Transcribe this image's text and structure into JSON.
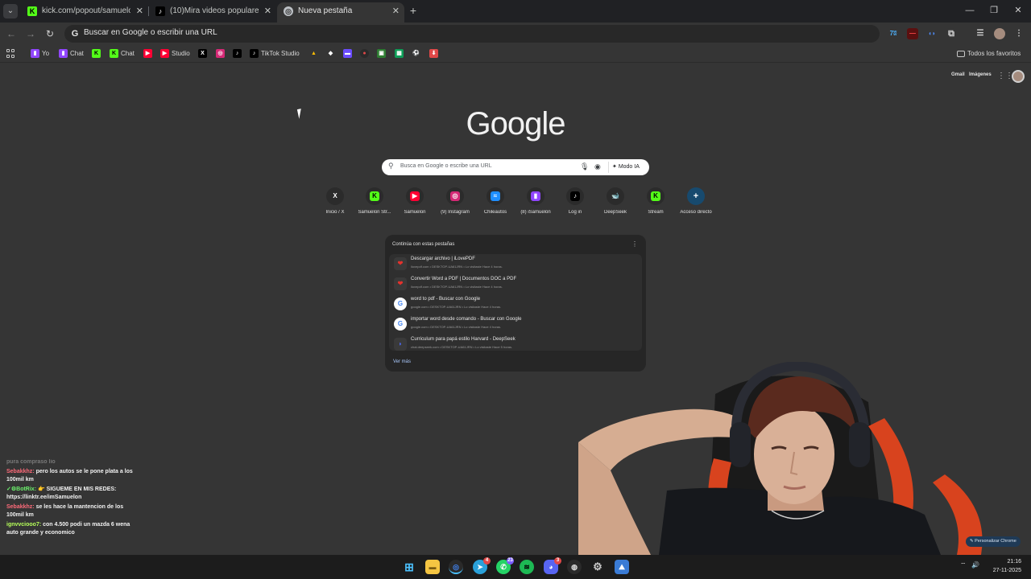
{
  "colors": {
    "accent": "#a8c7fa",
    "kick": "#53fc18",
    "twitch": "#9146ff",
    "youtube": "#ff0033"
  },
  "tabs": [
    {
      "title": "kick.com/popout/samuelon/chat",
      "icon": "kick-icon"
    },
    {
      "title": "(10)Mira videos populares seleccionados",
      "icon": "tiktok-icon"
    },
    {
      "title": "Nueva pestaña",
      "icon": "chrome-icon",
      "active": true
    }
  ],
  "omnibox": {
    "placeholder": "Buscar en Google o escribir una URL"
  },
  "bookmarks": {
    "items": [
      {
        "label": "Yo",
        "icon": "twitch-icon"
      },
      {
        "label": "Chat",
        "icon": "twitch-icon"
      },
      {
        "label": "",
        "icon": "kick-icon"
      },
      {
        "label": "Chat",
        "icon": "kick-icon"
      },
      {
        "label": "",
        "icon": "youtube-icon"
      },
      {
        "label": "Studio",
        "icon": "youtube-icon"
      },
      {
        "label": "",
        "icon": "x-icon"
      },
      {
        "label": "",
        "icon": "instagram-icon"
      },
      {
        "label": "",
        "icon": "tiktok-icon"
      },
      {
        "label": "TikTok Studio",
        "icon": "tiktok-icon"
      }
    ],
    "all_label": "Todos los favoritos"
  },
  "ntp": {
    "gmail": "Gmail",
    "images": "Imágenes",
    "logo": "Google",
    "search_placeholder": "Busca en Google o escribe una URL",
    "ai_mode": "Modo IA",
    "shortcuts": [
      {
        "label": "Inicio / X",
        "icon": "x-icon"
      },
      {
        "label": "Samuelon Str...",
        "icon": "kick-icon"
      },
      {
        "label": "Samuelon",
        "icon": "youtube-icon"
      },
      {
        "label": "(9) Instagram",
        "icon": "instagram-icon"
      },
      {
        "label": "Chileautos",
        "icon": "chileautos-icon"
      },
      {
        "label": "(8) iSamuelon",
        "icon": "twitch-icon"
      },
      {
        "label": "Log in",
        "icon": "tiktok-icon"
      },
      {
        "label": "DeepSeek",
        "icon": "deepseek-icon"
      },
      {
        "label": "Stream",
        "icon": "kick-icon"
      },
      {
        "label": "Acceso directo",
        "icon": "plus-icon"
      }
    ],
    "continue": {
      "heading": "Continúa con estas pestañas",
      "rows": [
        {
          "title": "Descargar archivo | iLovePDF",
          "sub": "ilovepdf.com • DESKTOP-UA61JRN • Lo visitaste Hace 4 horas.",
          "icon": "ilovepdf-icon"
        },
        {
          "title": "Convertir Word a PDF | Documentos DOC a PDF",
          "sub": "ilovepdf.com • DESKTOP-UA61JRN • Lo visitaste Hace 4 horas.",
          "icon": "ilovepdf-icon"
        },
        {
          "title": "word to pdf - Buscar con Google",
          "sub": "google.com • DESKTOP-UA61JRN • Lo visitaste Hace 4 horas.",
          "icon": "google-icon"
        },
        {
          "title": "importar word desde comando - Buscar con Google",
          "sub": "google.com • DESKTOP-UA61JRN • Lo visitaste Hace 4 horas.",
          "icon": "google-icon"
        },
        {
          "title": "Curriculum para papá estilo Harvard - DeepSeek",
          "sub": "chat.deepseek.com • DESKTOP-UA61JRN • Lo visitaste Hace 5 horas.",
          "icon": "deepseek-icon"
        }
      ],
      "more": "Ver más"
    },
    "customize": "Personalizar Chrome"
  },
  "chat": [
    {
      "user": "",
      "text": "pura compraso lio",
      "faded": true
    },
    {
      "user": "Sebakkhz:",
      "text": "pero los autos se le pone plata a los 100mil km"
    },
    {
      "user": "✓⚙BotRix:",
      "text": "👉 SIGUEME EN MIS REDES: https://linktr.ee/imSamuelon"
    },
    {
      "user": "Sebakkhz:",
      "text": "se les hace la mantencion de los 100mil km"
    },
    {
      "user": "ignvvciooo7:",
      "text": "con 4.500 podi un mazda 6 wena auto grande y economico"
    }
  ],
  "taskbar": {
    "badges": {
      "telegram": "4",
      "whatsapp": "23",
      "discord": "3"
    },
    "time": "21:16",
    "date": "27-11-2025"
  }
}
